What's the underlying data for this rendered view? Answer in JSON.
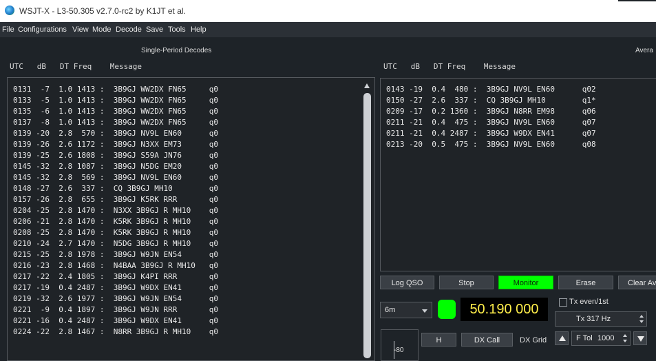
{
  "window": {
    "title": "WSJT-X - L3-50.305   v2.7.0-rc2   by K1JT et al."
  },
  "menu": [
    "File",
    "Configurations",
    "View",
    "Mode",
    "Decode",
    "Save",
    "Tools",
    "Help"
  ],
  "left_panel": {
    "title": "Single-Period Decodes",
    "header": "UTC   dB   DT Freq    Message",
    "rows": [
      "0131  -7  1.0 1413 :  3B9GJ WW2DX FN65     q0",
      "0133  -5  1.0 1413 :  3B9GJ WW2DX FN65     q0",
      "0135  -6  1.0 1413 :  3B9GJ WW2DX FN65     q0",
      "0137  -8  1.0 1413 :  3B9GJ WW2DX FN65     q0",
      "0139 -20  2.8  570 :  3B9GJ NV9L EN60      q0",
      "0139 -26  2.6 1172 :  3B9GJ N3XX EM73      q0",
      "0139 -25  2.6 1808 :  3B9GJ S59A JN76      q0",
      "0145 -32  2.8 1087 :  3B9GJ N5DG EM20      q0",
      "0145 -32  2.8  569 :  3B9GJ NV9L EN60      q0",
      "0148 -27  2.6  337 :  CQ 3B9GJ MH10        q0",
      "0157 -26  2.8  655 :  3B9GJ K5RK RRR       q0",
      "0204 -25  2.8 1470 :  N3XX 3B9GJ R MH10    q0",
      "0206 -21  2.8 1470 :  K5RK 3B9GJ R MH10    q0",
      "0208 -25  2.8 1470 :  K5RK 3B9GJ R MH10    q0",
      "0210 -24  2.7 1470 :  N5DG 3B9GJ R MH10    q0",
      "0215 -25  2.8 1978 :  3B9GJ W9JN EN54      q0",
      "0216 -23  2.8 1468 :  N4BAA 3B9GJ R MH10   q0",
      "0217 -22  2.4 1805 :  3B9GJ K4PI RRR       q0",
      "0217 -19  0.4 2487 :  3B9GJ W9DX EN41      q0",
      "0219 -32  2.6 1977 :  3B9GJ W9JN EN54      q0",
      "0221  -9  0.4 1897 :  3B9GJ W9JN RRR       q0",
      "0221 -16  0.4 2487 :  3B9GJ W9DX EN41      q0",
      "0224 -22  2.8 1467 :  N8RR 3B9GJ R MH10    q0"
    ]
  },
  "right_panel": {
    "title": "Avera",
    "header": "UTC   dB   DT Freq    Message",
    "rows": [
      "0143 -19  0.4  480 :  3B9GJ NV9L EN60      q02",
      "0150 -27  2.6  337 :  CQ 3B9GJ MH10        q1*",
      "0209 -17  0.2 1360 :  3B9GJ N8RR EM98      q06",
      "0211 -21  0.4  475 :  3B9GJ NV9L EN60      q07",
      "0211 -21  0.4 2487 :  3B9GJ W9DX EN41      q07",
      "0213 -20  0.5  475 :  3B9GJ NV9L EN60      q08"
    ]
  },
  "buttons": {
    "log_qso": "Log QSO",
    "stop": "Stop",
    "monitor": "Monitor",
    "erase": "Erase",
    "clear_avg": "Clear Av",
    "h": "H",
    "dx_call": "DX Call",
    "dx_grid": "DX Grid"
  },
  "controls": {
    "band": "6m",
    "dial_frequency": "50.190 000",
    "tx_even_label": "Tx even/1st",
    "tx_freq": "Tx  317 Hz",
    "f_tol_label": "F Tol",
    "f_tol_value": "1000",
    "meter_tick": "-80"
  },
  "colors": {
    "monitor_active": "#00ff00",
    "frequency_text": "#ffee4a",
    "background": "#1e2328"
  }
}
